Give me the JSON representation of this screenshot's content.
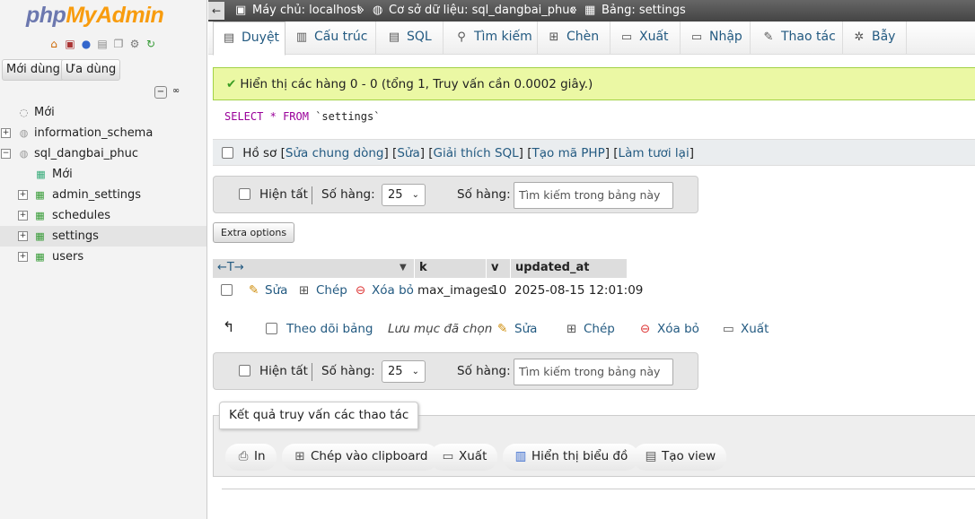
{
  "sidebar": {
    "logo_php": "php",
    "logo_admin": "MyAdmin",
    "btn_recent": "Mới dùng",
    "btn_fav": "Ưa dùng",
    "tree": [
      {
        "label": "Mới"
      },
      {
        "label": "information_schema"
      },
      {
        "label": "sql_dangbai_phuc"
      },
      {
        "label": "Mới"
      },
      {
        "label": "admin_settings"
      },
      {
        "label": "schedules"
      },
      {
        "label": "settings"
      },
      {
        "label": "users"
      }
    ]
  },
  "breadcrumb": {
    "server": "Máy chủ: localhost",
    "sep1": "»",
    "db": "Cơ sở dữ liệu: sql_dangbai_phuc",
    "sep2": "»",
    "table": "Bảng: settings"
  },
  "tabs": [
    "Duyệt",
    "Cấu trúc",
    "SQL",
    "Tìm kiếm",
    "Chèn",
    "Xuất",
    "Nhập",
    "Thao tác",
    "Bẫy"
  ],
  "message": "Hiển thị các hàng 0 - 0 (tổng 1, Truy vấn cần 0.0002 giây.)",
  "sql": {
    "kw1": "SELECT",
    "star": "*",
    "kw2": "FROM",
    "table": "`settings`"
  },
  "profile": {
    "label": "Hồ sơ",
    "open": "[",
    "l1": "Sửa chung dòng",
    "s1": "] [",
    "l2": "Sửa",
    "s2": "] [",
    "l3": "Giải thích SQL",
    "s3": "] [",
    "l4": "Tạo mã PHP",
    "s4": "] [",
    "l5": "Làm tươi lại",
    "close": "]"
  },
  "nav": {
    "show_all": "Hiện tất",
    "rows_label": "Số hàng:",
    "rows_value": "25",
    "filter_label": "Số hàng:",
    "search_placeholder": "Tìm kiếm trong bảng này"
  },
  "extra_options": "Extra options",
  "table": {
    "arrows": "←T→",
    "columns": [
      "k",
      "v",
      "updated_at"
    ],
    "row": {
      "edit": "Sửa",
      "copy": "Chép",
      "delete": "Xóa bỏ",
      "k": "max_images",
      "v": "10",
      "updated_at": "2025-08-15 12:01:09"
    }
  },
  "bulk": {
    "check_all": "Theo dõi bảng",
    "with_selected": "Lưu mục đã chọn",
    "edit": "Sửa",
    "copy": "Chép",
    "delete": "Xóa bỏ",
    "export": "Xuất"
  },
  "query_results": {
    "title": "Kết quả truy vấn các thao tác",
    "print": "In",
    "clipboard": "Chép vào clipboard",
    "export": "Xuất",
    "chart": "Hiển thị biểu đồ",
    "view": "Tạo view"
  }
}
